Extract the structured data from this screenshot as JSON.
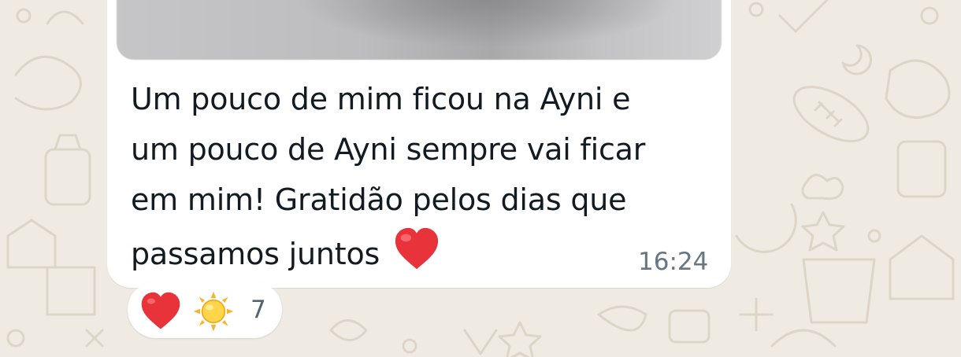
{
  "message": {
    "lines": [
      "Um pouco de mim ficou na Ayni e",
      "um pouco de Ayni sempre vai ficar",
      "em mim! Gratidão pelos dias que",
      "passamos juntos"
    ],
    "emoji": "red-heart",
    "time": "16:24"
  },
  "reactions": {
    "emojis": [
      "red-heart",
      "sun-with-face"
    ],
    "count": "7"
  },
  "colors": {
    "background": "#efeae2",
    "bubble": "#ffffff",
    "text": "#111b21",
    "timestamp": "#667781",
    "heart": "#e8333b"
  }
}
